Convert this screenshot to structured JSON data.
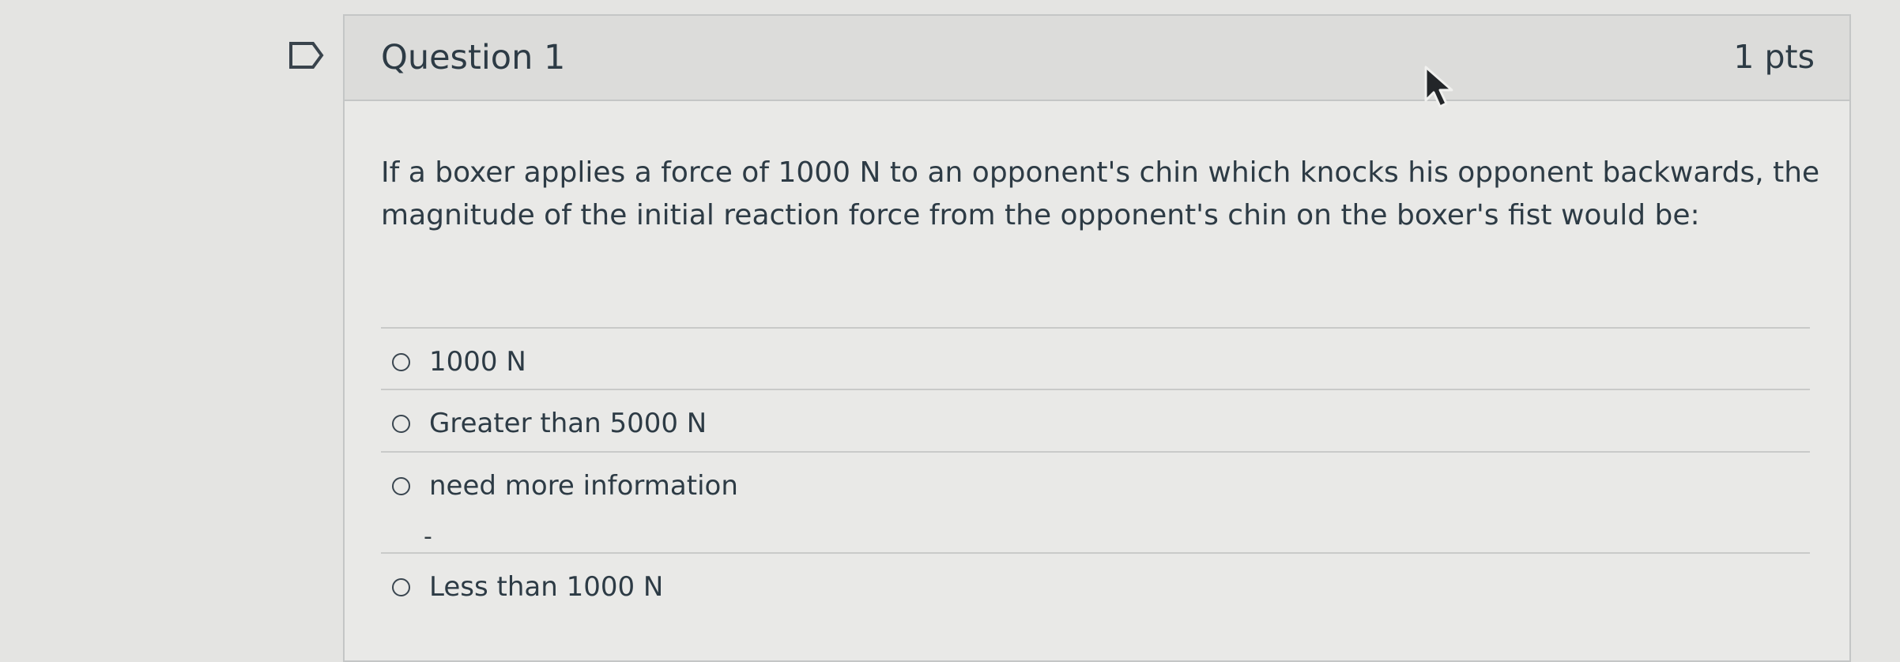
{
  "question": {
    "title": "Question 1",
    "points": "1 pts",
    "text": "If a boxer applies a force of 1000 N to an opponent's chin which knocks his opponent backwards, the magnitude of the initial reaction force from the opponent's chin on the boxer's fist would be:",
    "selected_answer": null,
    "answers": [
      {
        "label": "1000 N",
        "selected": false
      },
      {
        "label": "Greater than 5000 N",
        "selected": false
      },
      {
        "label": "need more information",
        "selected": false
      },
      {
        "label": "Less than 1000 N",
        "selected": false
      }
    ],
    "stray_mark": "-"
  },
  "icons": {
    "flag": "bookmark-flag-icon",
    "cursor": "mouse-pointer-icon",
    "radio": "empty-radio-circle"
  },
  "colors": {
    "page_background": "#e4e4e2",
    "card_background": "#e9e9e7",
    "header_background": "#dcdcda",
    "border": "#c4c6c6",
    "text": "#2d3b45"
  }
}
